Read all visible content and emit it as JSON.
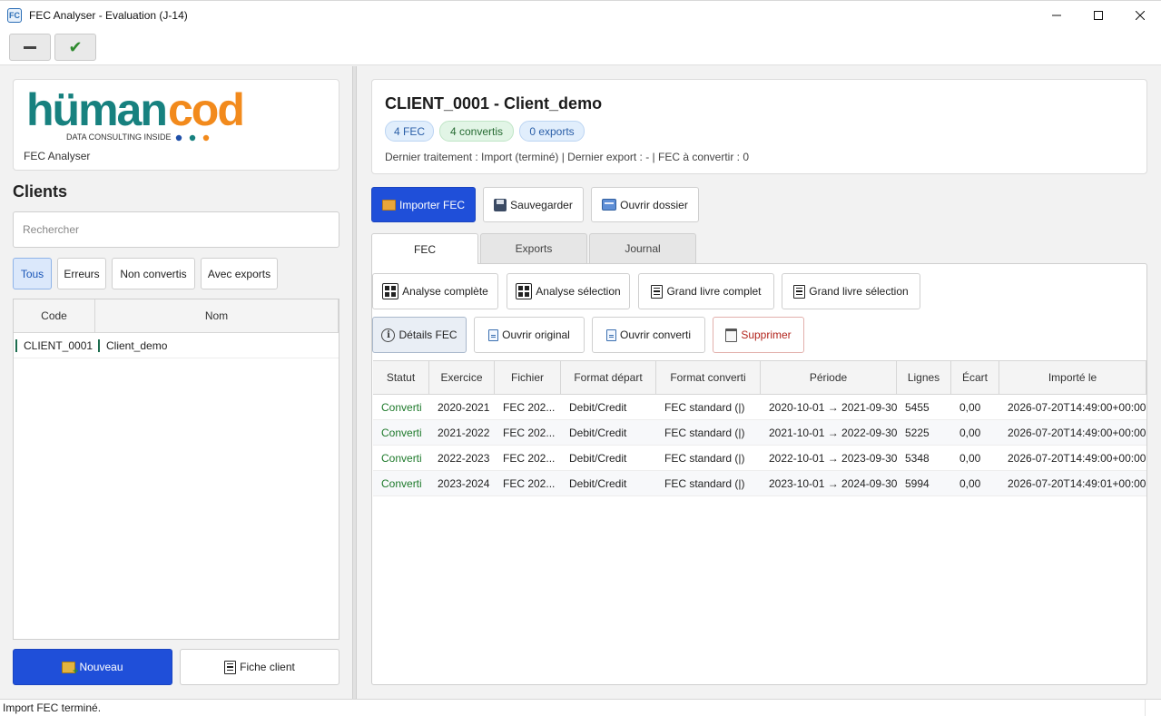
{
  "window": {
    "title": "FEC Analyser - Evaluation (J-14)",
    "app_icon": "FC"
  },
  "toolbar": {
    "minus_icon": "minus-icon",
    "check_icon": "check-icon"
  },
  "sidebar": {
    "logo_main": "humancod",
    "logo_tagline": "DATA CONSULTING INSIDE",
    "app_name": "FEC Analyser",
    "clients_title": "Clients",
    "search_placeholder": "Rechercher",
    "filters": [
      "Tous",
      "Erreurs",
      "Non convertis",
      "Avec exports"
    ],
    "active_filter": "Tous",
    "table_headers": [
      "Code",
      "Nom"
    ],
    "rows": [
      {
        "code": "CLIENT_0001",
        "nom": "Client_demo"
      }
    ],
    "new_button": "Nouveau",
    "fiche_button": "Fiche client"
  },
  "client": {
    "title": "CLIENT_0001 - Client_demo",
    "badges": [
      "4 FEC",
      "4 convertis",
      "0 exports"
    ],
    "meta": "Dernier traitement : Import (terminé)  |  Dernier export : -  |  FEC à convertir : 0",
    "colors": {
      "badge_blue": "#e1eefc",
      "badge_green": "#e2f5e6",
      "primary": "#1f4fd9",
      "status_ok": "#1e7a2b"
    }
  },
  "actions": {
    "import": "Importer FEC",
    "save": "Sauvegarder",
    "open_folder": "Ouvrir dossier"
  },
  "tabs": [
    "FEC",
    "Exports",
    "Journal"
  ],
  "active_tab": "FEC",
  "fec_actions": {
    "analyse_complete": "Analyse complète",
    "analyse_selection": "Analyse sélection",
    "grand_livre_complet": "Grand livre complet",
    "grand_livre_selection": "Grand livre sélection",
    "details": "Détails FEC",
    "ouvrir_original": "Ouvrir original",
    "ouvrir_converti": "Ouvrir converti",
    "supprimer": "Supprimer"
  },
  "fec_table": {
    "headers": [
      "Statut",
      "Exercice",
      "Fichier",
      "Format départ",
      "Format converti",
      "Période",
      "Lignes",
      "Écart",
      "Importé le"
    ],
    "rows": [
      [
        "Converti",
        "2020-2021",
        "FEC 202...",
        "Debit/Credit",
        "FEC standard (|)",
        "2020-10-01 → 2021-09-30",
        "5455",
        "0,00",
        "2026-07-20T14:49:00+00:00"
      ],
      [
        "Converti",
        "2021-2022",
        "FEC 202...",
        "Debit/Credit",
        "FEC standard (|)",
        "2021-10-01 → 2022-09-30",
        "5225",
        "0,00",
        "2026-07-20T14:49:00+00:00"
      ],
      [
        "Converti",
        "2022-2023",
        "FEC 202...",
        "Debit/Credit",
        "FEC standard (|)",
        "2022-10-01 → 2023-09-30",
        "5348",
        "0,00",
        "2026-07-20T14:49:00+00:00"
      ],
      [
        "Converti",
        "2023-2024",
        "FEC 202...",
        "Debit/Credit",
        "FEC standard (|)",
        "2023-10-01 → 2024-09-30",
        "5994",
        "0,00",
        "2026-07-20T14:49:01+00:00"
      ]
    ]
  },
  "status_bar": "Import FEC terminé."
}
